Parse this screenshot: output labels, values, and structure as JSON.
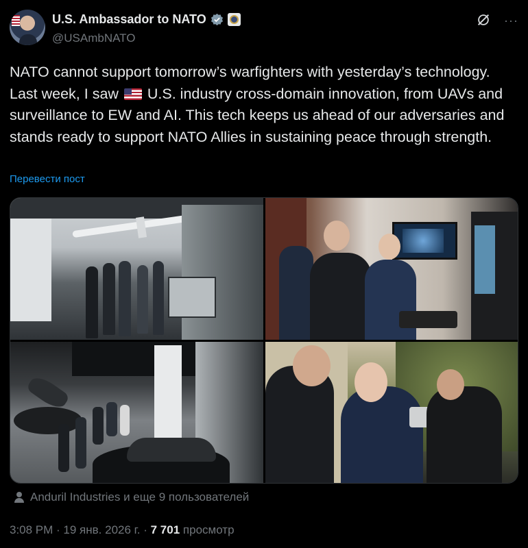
{
  "author": {
    "display_name": "U.S. Ambassador to NATO",
    "handle": "@USAmbNATO",
    "verified_icon": "verified-badge-icon",
    "affiliation_icon": "us-mission-seal-icon"
  },
  "header_actions": {
    "grok_icon": "grok-icon",
    "more_label": "···"
  },
  "tweet": {
    "text_part1": "NATO cannot support tomorrow’s warfighters with yesterday’s technology. Last week, I saw ",
    "flag": "🇺🇸",
    "text_part2": " U.S. industry cross-domain innovation, from UAVs and surveillance to EW and AI. This tech keeps us ahead of our adversaries and stands ready to support NATO Allies in sustaining peace through strength.",
    "translate_label": "Перевести пост"
  },
  "media": {
    "count": 4,
    "photos": [
      "hangar-drone-display-photo",
      "meeting-room-screen-photo",
      "factory-floor-tour-photo",
      "outdoor-drone-demo-photo"
    ]
  },
  "tagged": {
    "icon": "person-icon",
    "label": "Anduril Industries и еще 9 пользователей"
  },
  "meta": {
    "time": "3:08 PM",
    "separator": " · ",
    "date": "19 янв. 2026 г.",
    "views_count": "7 701",
    "views_label": "просмотр"
  },
  "colors": {
    "background": "#000000",
    "text_primary": "#e7e9ea",
    "text_secondary": "#71767b",
    "link": "#1d9bf0",
    "verified": "#829aab"
  }
}
